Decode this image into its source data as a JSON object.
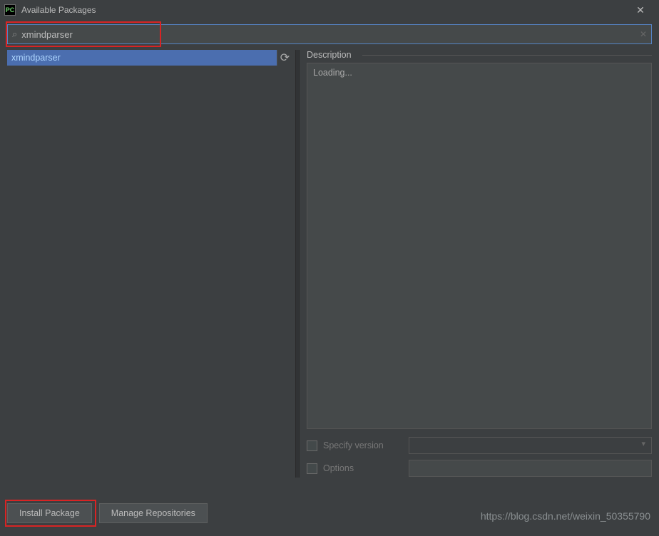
{
  "titlebar": {
    "icon_text": "PC",
    "title": "Available Packages"
  },
  "search": {
    "value": "xmindparser"
  },
  "list": {
    "items": [
      "xmindparser"
    ]
  },
  "description": {
    "label": "Description",
    "status": "Loading..."
  },
  "version_row": {
    "label": "Specify version"
  },
  "options_row": {
    "label": "Options",
    "value": ""
  },
  "buttons": {
    "install": "Install Package",
    "manage": "Manage Repositories"
  },
  "watermark": "https://blog.csdn.net/weixin_50355790"
}
